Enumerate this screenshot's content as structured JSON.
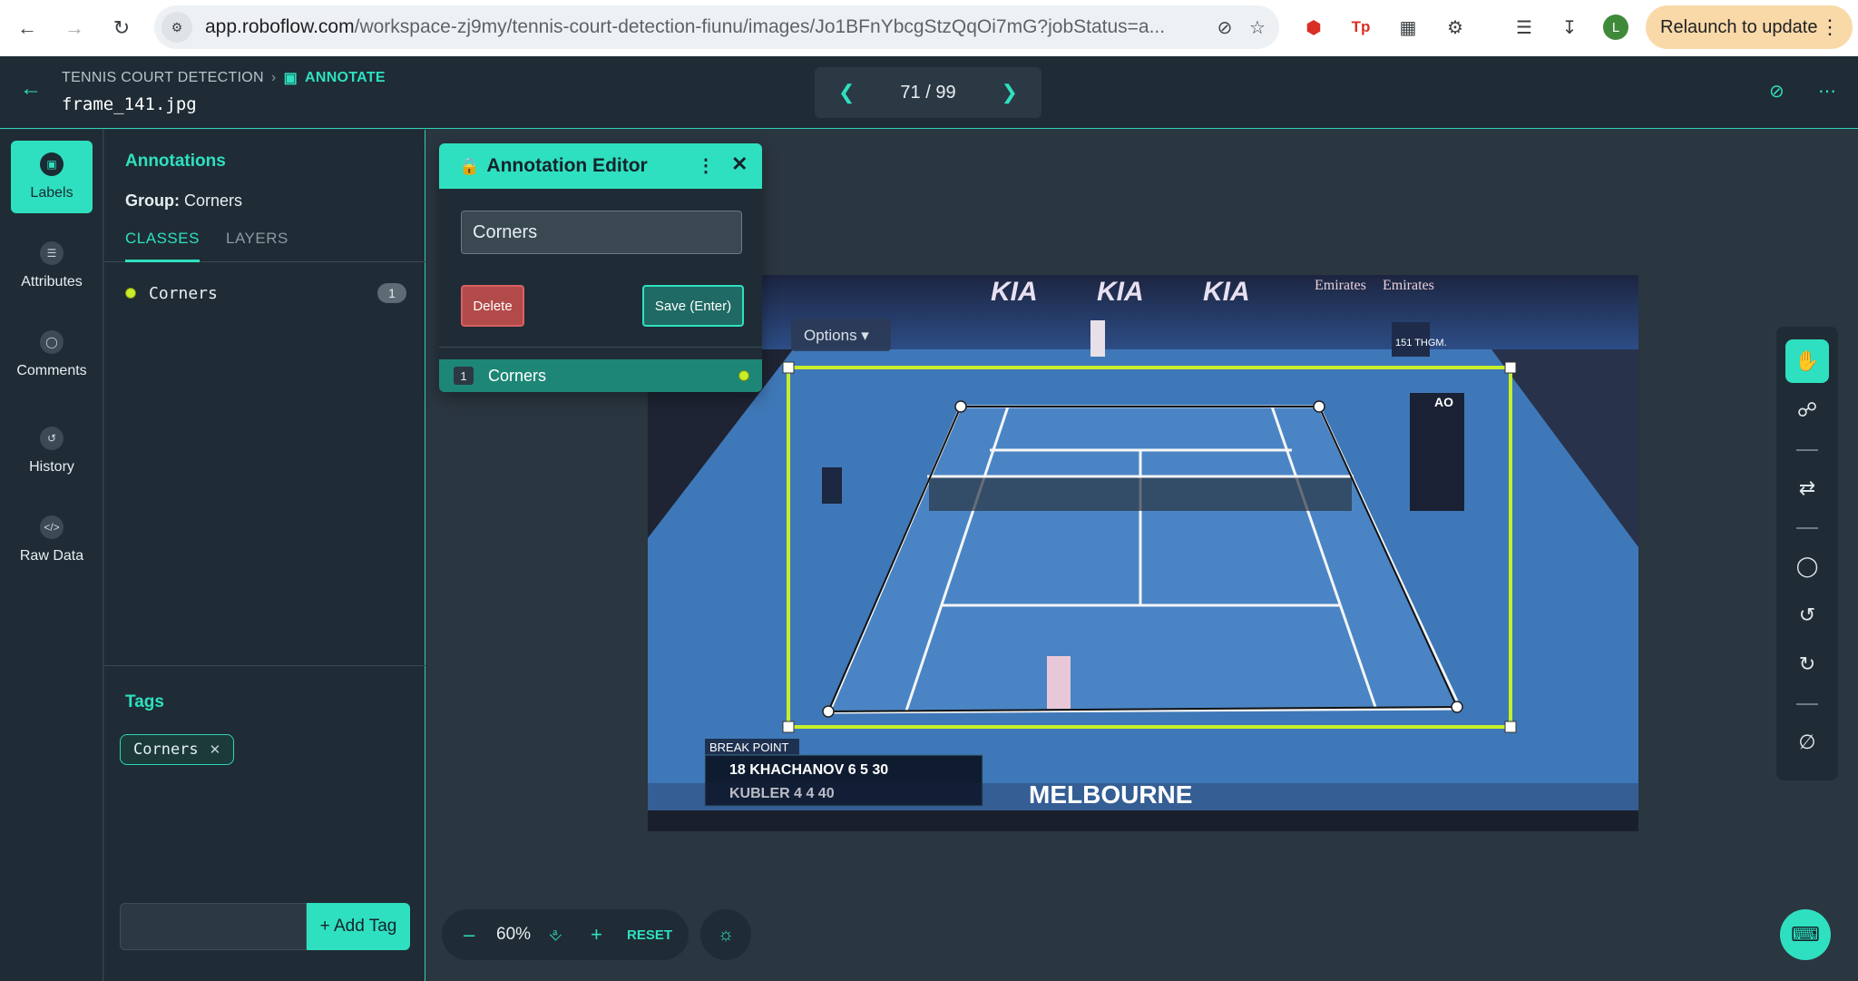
{
  "browser": {
    "url_host": "app.roboflow.com",
    "url_path": "/workspace-zj9my/tennis-court-detection-fiunu/images/Jo1BFnYbcgStzQqOi7mG?jobStatus=a...",
    "relaunch_label": "Relaunch to update",
    "profile_initial": "L"
  },
  "header": {
    "project": "TENNIS COURT DETECTION",
    "mode": "ANNOTATE",
    "filename": "frame_141.jpg",
    "pager": "71 / 99"
  },
  "rail": {
    "items": [
      {
        "label": "Labels"
      },
      {
        "label": "Attributes"
      },
      {
        "label": "Comments"
      },
      {
        "label": "History"
      },
      {
        "label": "Raw Data"
      }
    ]
  },
  "panel": {
    "title": "Annotations",
    "group_label": "Group:",
    "group_value": "Corners",
    "tabs": [
      "CLASSES",
      "LAYERS"
    ],
    "classes": [
      {
        "name": "Corners",
        "count": "1",
        "color": "#c8ee2a"
      }
    ],
    "tags_title": "Tags",
    "tags": [
      "Corners"
    ],
    "add_tag_label": "+ Add Tag"
  },
  "editor": {
    "title": "Annotation Editor",
    "class_value": "Corners",
    "delete_label": "Delete",
    "save_label": "Save (Enter)",
    "rows": [
      {
        "index": "1",
        "name": "Corners"
      }
    ]
  },
  "image_overlay": {
    "options_label": "Options",
    "scoreboard": {
      "title": "BREAK POINT",
      "p1": {
        "seed": "18",
        "name": "KHACHANOV",
        "s1": "6",
        "s2": "5",
        "pts": "30"
      },
      "p2": {
        "name": "KUBLER",
        "s1": "4",
        "s2": "4",
        "pts": "40"
      }
    },
    "banner": "MELBOURNE",
    "sponsors": [
      "KIA",
      "KIA",
      "KIA",
      "Emirates",
      "Emirates"
    ],
    "board_text": "151 THGM.",
    "ao_label": "AO"
  },
  "zoom": {
    "minus": "–",
    "percent": "60%",
    "plus": "+",
    "reset": "RESET"
  },
  "colors": {
    "accent": "#2fe0c0",
    "annotation": "#c8ee2a",
    "panel_bg": "#1f2c35",
    "canvas_bg": "#2a3640",
    "court_blue": "#4a84c4"
  }
}
